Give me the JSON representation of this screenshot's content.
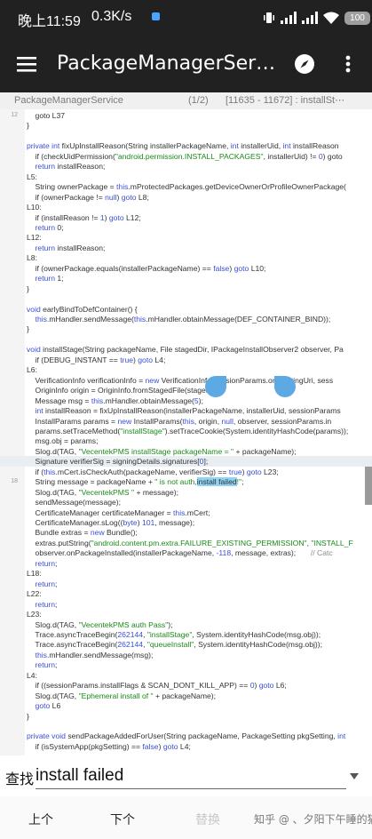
{
  "status_bar": {
    "time": "晚上11:59",
    "net_speed": "0.3K/s",
    "battery": "100"
  },
  "app_bar": {
    "title": "PackageManagerServi⋯",
    "icons": [
      "menu-icon",
      "compass-icon",
      "more-vert-icon"
    ]
  },
  "file_bar": {
    "file_name": "PackageManagerService",
    "match_count": "(1/2)",
    "range": "[11635 - 11672] : installSt⋯"
  },
  "code": {
    "current_line": 34,
    "lines": [
      {
        "n": "12",
        "t": [
          [
            "    goto L37",
            ""
          ]
        ]
      },
      {
        "n": "",
        "t": [
          [
            "}",
            ""
          ]
        ]
      },
      {
        "n": "",
        "t": []
      },
      {
        "n": "",
        "t": [
          [
            "private int ",
            "kw"
          ],
          [
            "fixUpInstallReason(String installerPackageName, ",
            ""
          ],
          [
            "int",
            "kw"
          ],
          [
            " installerUid, ",
            ""
          ],
          [
            "int",
            "kw"
          ],
          [
            " installReason",
            ""
          ]
        ]
      },
      {
        "n": "",
        "t": [
          [
            "    if (checkUidPermission(",
            ""
          ],
          [
            "\"android.permission.INSTALL_PACKAGES\"",
            "str"
          ],
          [
            ", installerUid) != ",
            ""
          ],
          [
            "0",
            "num"
          ],
          [
            ") goto",
            ""
          ]
        ]
      },
      {
        "n": "",
        "t": [
          [
            "    return",
            "kw"
          ],
          [
            " installReason;",
            ""
          ]
        ]
      },
      {
        "n": "",
        "t": [
          [
            "L5:",
            ""
          ]
        ]
      },
      {
        "n": "",
        "t": [
          [
            "    String ownerPackage = ",
            ""
          ],
          [
            "this",
            "kw"
          ],
          [
            ".mProtectedPackages.getDeviceOwnerOrProfileOwnerPackage(",
            ""
          ]
        ]
      },
      {
        "n": "",
        "t": [
          [
            "    if (ownerPackage != ",
            ""
          ],
          [
            "null",
            "kw"
          ],
          [
            ") ",
            ""
          ],
          [
            "goto",
            "kw"
          ],
          [
            " L8;",
            ""
          ]
        ]
      },
      {
        "n": "",
        "t": [
          [
            "L10:",
            ""
          ]
        ]
      },
      {
        "n": "",
        "t": [
          [
            "    if (installReason != ",
            ""
          ],
          [
            "1",
            "num"
          ],
          [
            ") ",
            ""
          ],
          [
            "goto",
            "kw"
          ],
          [
            " L12;",
            ""
          ]
        ]
      },
      {
        "n": "",
        "t": [
          [
            "    return",
            "kw"
          ],
          [
            " 0;",
            ""
          ]
        ]
      },
      {
        "n": "",
        "t": [
          [
            "L12:",
            ""
          ]
        ]
      },
      {
        "n": "",
        "t": [
          [
            "    return",
            "kw"
          ],
          [
            " installReason;",
            ""
          ]
        ]
      },
      {
        "n": "",
        "t": [
          [
            "L8:",
            ""
          ]
        ]
      },
      {
        "n": "",
        "t": [
          [
            "    if (ownerPackage.equals(installerPackageName) == ",
            ""
          ],
          [
            "false",
            "kw"
          ],
          [
            ") ",
            ""
          ],
          [
            "goto",
            "kw"
          ],
          [
            " L10;",
            ""
          ]
        ]
      },
      {
        "n": "",
        "t": [
          [
            "    return",
            "kw"
          ],
          [
            " 1;",
            ""
          ]
        ]
      },
      {
        "n": "",
        "t": [
          [
            "}",
            ""
          ]
        ]
      },
      {
        "n": "",
        "t": []
      },
      {
        "n": "",
        "t": [
          [
            "void ",
            "kw"
          ],
          [
            "earlyBindToDefContainer() {",
            ""
          ]
        ]
      },
      {
        "n": "",
        "t": [
          [
            "    ",
            ""
          ],
          [
            "this",
            "kw"
          ],
          [
            ".mHandler.sendMessage(",
            ""
          ],
          [
            "this",
            "kw"
          ],
          [
            ".mHandler.obtainMessage(DEF_CONTAINER_BIND));",
            ""
          ]
        ]
      },
      {
        "n": "",
        "t": [
          [
            "}",
            ""
          ]
        ]
      },
      {
        "n": "",
        "t": []
      },
      {
        "n": "",
        "t": [
          [
            "void ",
            "kw"
          ],
          [
            "installStage(String packageName, File stagedDir, IPackageInstallObserver2 observer, Pa",
            ""
          ]
        ]
      },
      {
        "n": "",
        "t": [
          [
            "    if (DEBUG_INSTANT == ",
            ""
          ],
          [
            "true",
            "kw"
          ],
          [
            ") ",
            ""
          ],
          [
            "goto",
            "kw"
          ],
          [
            " L4;",
            ""
          ]
        ]
      },
      {
        "n": "",
        "t": [
          [
            "L6:",
            ""
          ]
        ]
      },
      {
        "n": "",
        "t": [
          [
            "    VerificationInfo verificationInfo = ",
            ""
          ],
          [
            "new",
            "kw"
          ],
          [
            " VerificationInfo(sessionParams.originatingUri, sess",
            ""
          ]
        ]
      },
      {
        "n": "",
        "t": [
          [
            "    OriginInfo origin = OriginInfo.fromStagedFile(stagedDir);",
            ""
          ]
        ]
      },
      {
        "n": "",
        "t": [
          [
            "    Message msg = ",
            ""
          ],
          [
            "this",
            "kw"
          ],
          [
            ".mHandler.obtainMessage(",
            ""
          ],
          [
            "5",
            "num"
          ],
          [
            ");",
            ""
          ]
        ]
      },
      {
        "n": "",
        "t": [
          [
            "    ",
            ""
          ],
          [
            "int",
            "kw"
          ],
          [
            " installReason = fixUpInstallReason(installerPackageName, installerUid, sessionParams",
            ""
          ]
        ]
      },
      {
        "n": "",
        "t": [
          [
            "    InstallParams params = ",
            ""
          ],
          [
            "new",
            "kw"
          ],
          [
            " InstallParams(",
            ""
          ],
          [
            "this",
            "kw"
          ],
          [
            ", origin, ",
            ""
          ],
          [
            "null",
            "kw"
          ],
          [
            ", observer, sessionParams.in",
            ""
          ]
        ]
      },
      {
        "n": "",
        "t": [
          [
            "    params.setTraceMethod(",
            ""
          ],
          [
            "\"installStage\"",
            "str"
          ],
          [
            ").setTraceCookie(System.identityHashCode(params));",
            ""
          ]
        ]
      },
      {
        "n": "",
        "t": [
          [
            "    msg.obj = params;",
            ""
          ]
        ]
      },
      {
        "n": "",
        "t": [
          [
            "    Slog.d(TAG, ",
            ""
          ],
          [
            "\"VecentekPMS installStage packageName = \"",
            "str"
          ],
          [
            " + packageName);",
            ""
          ]
        ]
      },
      {
        "n": "",
        "t": [
          [
            "    Signature verifierSig = signingDetails.signatures[",
            ""
          ],
          [
            "0",
            "num"
          ],
          [
            "];",
            ""
          ]
        ]
      },
      {
        "n": "",
        "t": [
          [
            "    if (",
            ""
          ],
          [
            "this",
            "kw"
          ],
          [
            ".mCert.isCheckAuth(packageName, verifierSig) == ",
            ""
          ],
          [
            "true",
            "kw"
          ],
          [
            ") ",
            ""
          ],
          [
            "goto",
            "kw"
          ],
          [
            " L23;",
            ""
          ]
        ]
      },
      {
        "n": "18",
        "t": [
          [
            "    String message = packageName + ",
            ""
          ],
          [
            "\" is not auth,",
            "str"
          ],
          [
            "install failed",
            "hl"
          ],
          [
            "!\"",
            "str"
          ],
          [
            ";",
            ""
          ]
        ]
      },
      {
        "n": "",
        "t": [
          [
            "    Slog.d(TAG, ",
            ""
          ],
          [
            "\"VecentekPMS \"",
            "str"
          ],
          [
            " + message);",
            ""
          ]
        ]
      },
      {
        "n": "",
        "t": [
          [
            "    sendMessage(message);",
            ""
          ]
        ]
      },
      {
        "n": "",
        "t": [
          [
            "    CertificateManager certificateManager = ",
            ""
          ],
          [
            "this",
            "kw"
          ],
          [
            ".mCert;",
            ""
          ]
        ]
      },
      {
        "n": "",
        "t": [
          [
            "    CertificateManager.sLog((",
            ""
          ],
          [
            "byte",
            "kw"
          ],
          [
            ") ",
            ""
          ],
          [
            "101",
            "num"
          ],
          [
            ", message);",
            ""
          ]
        ]
      },
      {
        "n": "",
        "t": [
          [
            "    Bundle extras = ",
            ""
          ],
          [
            "new",
            "kw"
          ],
          [
            " Bundle();",
            ""
          ]
        ]
      },
      {
        "n": "",
        "t": [
          [
            "    extras.putString(",
            ""
          ],
          [
            "\"android.content.pm.extra.FAILURE_EXISTING_PERMISSION\"",
            "str"
          ],
          [
            ", ",
            ""
          ],
          [
            "\"INSTALL_F",
            "str"
          ]
        ]
      },
      {
        "n": "",
        "t": [
          [
            "    observer.onPackageInstalled(installerPackageName, ",
            ""
          ],
          [
            "-118",
            "num"
          ],
          [
            ", message, extras);       ",
            ""
          ],
          [
            "// Catc",
            "cm"
          ]
        ]
      },
      {
        "n": "",
        "t": [
          [
            "    return",
            "kw"
          ],
          [
            ";",
            ""
          ]
        ]
      },
      {
        "n": "",
        "t": [
          [
            "L18:",
            ""
          ]
        ]
      },
      {
        "n": "",
        "t": [
          [
            "    return",
            "kw"
          ],
          [
            ";",
            ""
          ]
        ]
      },
      {
        "n": "",
        "t": [
          [
            "L22:",
            ""
          ]
        ]
      },
      {
        "n": "",
        "t": [
          [
            "    return",
            "kw"
          ],
          [
            ";",
            ""
          ]
        ]
      },
      {
        "n": "",
        "t": [
          [
            "L23:",
            ""
          ]
        ]
      },
      {
        "n": "",
        "t": [
          [
            "    Slog.d(TAG, ",
            ""
          ],
          [
            "\"VecentekPMS auth Pass\"",
            "str"
          ],
          [
            ");",
            ""
          ]
        ]
      },
      {
        "n": "",
        "t": [
          [
            "    Trace.asyncTraceBegin(",
            ""
          ],
          [
            "262144",
            "num"
          ],
          [
            ", ",
            ""
          ],
          [
            "\"installStage\"",
            "str"
          ],
          [
            ", System.identityHashCode(msg.obj));",
            ""
          ]
        ]
      },
      {
        "n": "",
        "t": [
          [
            "    Trace.asyncTraceBegin(",
            ""
          ],
          [
            "262144",
            "num"
          ],
          [
            ", ",
            ""
          ],
          [
            "\"queueInstall\"",
            "str"
          ],
          [
            ", System.identityHashCode(msg.obj));",
            ""
          ]
        ]
      },
      {
        "n": "",
        "t": [
          [
            "    ",
            ""
          ],
          [
            "this",
            "kw"
          ],
          [
            ".mHandler.sendMessage(msg);",
            ""
          ]
        ]
      },
      {
        "n": "",
        "t": [
          [
            "    return",
            "kw"
          ],
          [
            ";",
            ""
          ]
        ]
      },
      {
        "n": "",
        "t": [
          [
            "L4:",
            ""
          ]
        ]
      },
      {
        "n": "",
        "t": [
          [
            "    if ((sessionParams.installFlags & SCAN_DONT_KILL_APP) == ",
            ""
          ],
          [
            "0",
            "num"
          ],
          [
            ") ",
            ""
          ],
          [
            "goto",
            "kw"
          ],
          [
            " L6;",
            ""
          ]
        ]
      },
      {
        "n": "",
        "t": [
          [
            "    Slog.d(TAG, ",
            ""
          ],
          [
            "\"Ephemeral install of \"",
            "str"
          ],
          [
            " + packageName);",
            ""
          ]
        ]
      },
      {
        "n": "",
        "t": [
          [
            "    goto",
            "kw"
          ],
          [
            " L6",
            ""
          ]
        ]
      },
      {
        "n": "",
        "t": [
          [
            "}",
            ""
          ]
        ]
      },
      {
        "n": "",
        "t": []
      },
      {
        "n": "",
        "t": [
          [
            "private void ",
            "kw"
          ],
          [
            "sendPackageAddedForUser(String packageName, PackageSetting pkgSetting, ",
            ""
          ],
          [
            "int",
            "kw"
          ]
        ]
      },
      {
        "n": "",
        "t": [
          [
            "    if (isSystemApp(pkgSetting) == ",
            ""
          ],
          [
            "false",
            "kw"
          ],
          [
            ") ",
            ""
          ],
          [
            "goto",
            "kw"
          ],
          [
            " L4;",
            ""
          ]
        ]
      }
    ]
  },
  "find": {
    "label": "查找",
    "query": "install failed"
  },
  "bottom_bar": {
    "prev_label": "上个",
    "next_label": "下个",
    "replace_label": "替换",
    "watermark": "知乎 @ 、夕阳下午睡的猫"
  }
}
